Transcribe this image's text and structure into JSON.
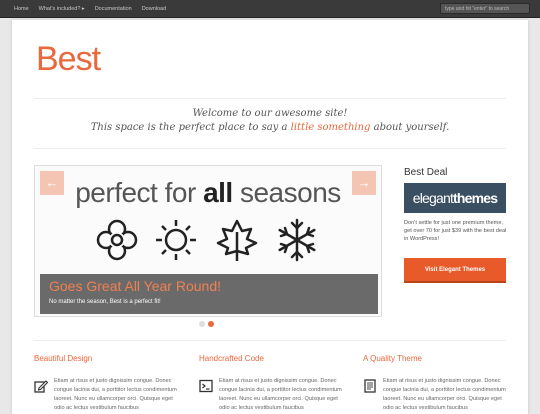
{
  "topnav": {
    "items": [
      "Home",
      "What's included? ▸",
      "Documentation",
      "Download"
    ],
    "search_placeholder": "type and hit \"enter\" to search"
  },
  "logo": "Best",
  "welcome": {
    "line1": "Welcome to our awesome site!",
    "line2_before": "This space is the perfect place to say a ",
    "line2_highlight": "little something",
    "line2_after": " about yourself."
  },
  "slider": {
    "title_before": "perfect for ",
    "title_bold": "all",
    "title_after": " seasons",
    "prev_glyph": "←",
    "next_glyph": "→",
    "icons": [
      "flower-icon",
      "sun-icon",
      "leaf-icon",
      "snowflake-icon"
    ],
    "caption_title": "Goes Great All Year Round!",
    "caption_text": "No matter the season, Best is a perfect fit!",
    "active_slide": 2,
    "slide_count": 2
  },
  "sidebar": {
    "title": "Best Deal",
    "ad_part1": "elegant",
    "ad_part2": "themes",
    "text": "Don't settle for just one premium theme, get over 70 for just $39 with the best deal in WordPress!",
    "button": "Visit Elegant Themes"
  },
  "features": [
    {
      "title": "Beautiful Design",
      "icon": "pencil-edit-icon",
      "text": "Etiam at risus et justo dignissim congue. Donec congue lacinia dui, a porttitor lectus condimentum laoreet. Nunc eu ullamcorper orci. Quisque eget odio ac lectus vestibulum faucibus"
    },
    {
      "title": "Handcrafted Code",
      "icon": "terminal-icon",
      "text": "Etiam at risus et justo dignissim congue. Donec congue lacinia dui, a porttitor lectus condimentum laoreet. Nunc eu ullamcorper orci. Quisque eget odio ac lectus vestibulum faucibus"
    },
    {
      "title": "A Quality Theme",
      "icon": "document-icon",
      "text": "Etiam at risus et justo dignissim congue. Donec congue lacinia dui, a porttitor lectus condimentum laoreet. Nunc eu ullamcorper orci. Quisque eget odio ac lectus vestibulum faucibus"
    }
  ],
  "colors": {
    "accent": "#e9683c",
    "topbar": "#3a3a3a",
    "caption_bg": "#6a6a6a",
    "button": "#e85a2a",
    "ad_bg": "#3b4f63"
  }
}
